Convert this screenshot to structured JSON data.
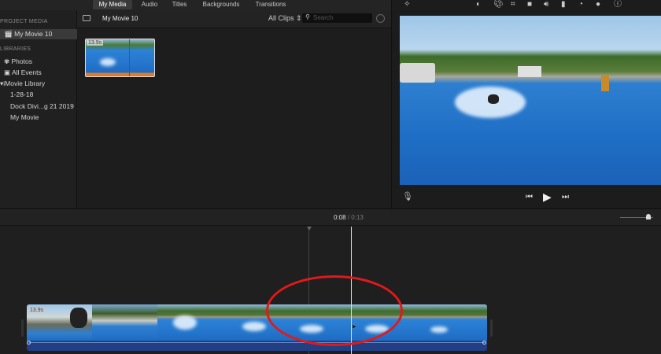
{
  "tabs": [
    "My Media",
    "Audio",
    "Titles",
    "Backgrounds",
    "Transitions"
  ],
  "sidebar": {
    "project_media": "PROJECT MEDIA",
    "project": "My Movie 10",
    "libraries": "LIBRARIES",
    "items": [
      "Photos",
      "All Events",
      "iMovie Library",
      "1-28-18",
      "Dock Divi...g 21 2019",
      "My Movie"
    ]
  },
  "browser": {
    "title": "My Movie 10",
    "filter": "All Clips",
    "search_placeholder": "Search",
    "clip_duration": "13.9s"
  },
  "viewer": {
    "icons": [
      "magic-wand",
      "color-balance",
      "color-correction",
      "crop",
      "stabilization",
      "volume",
      "equalizer",
      "speed",
      "noise-reduction",
      "info"
    ]
  },
  "timeline": {
    "current_time": "0:08",
    "separator": "/",
    "total_time": "0:13",
    "clip_duration": "13.9s"
  },
  "annotation": {
    "color": "#e0191b"
  }
}
